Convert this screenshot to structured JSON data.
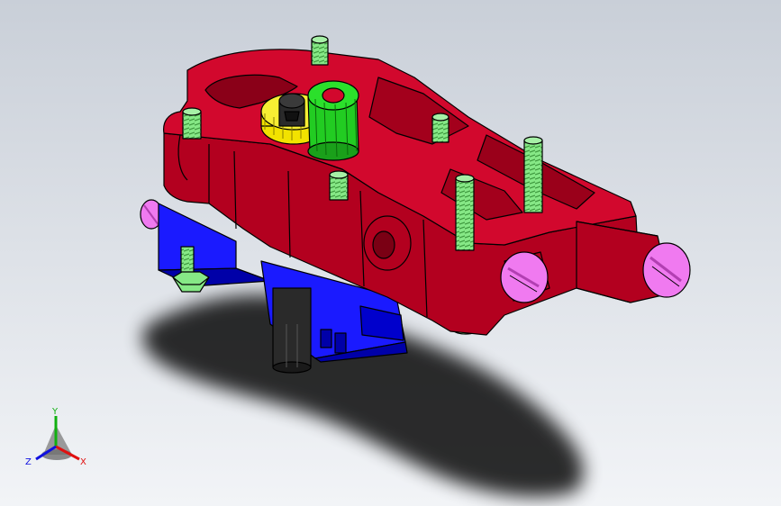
{
  "viewport": {
    "background_top": "#c9cfd8",
    "background_bottom": "#f2f4f7",
    "shadow_color": "#000000"
  },
  "model": {
    "colors": {
      "housing": "#b3001f",
      "housing_dark": "#7a0014",
      "housing_light": "#d2082d",
      "base_block": "#1a1aff",
      "base_block_dark": "#0000a8",
      "studs": "#86e886",
      "studs_dark": "#3f9a3f",
      "gear_green": "#22cc22",
      "gear_yellow": "#f2e200",
      "caps": "#f07af0",
      "caps_dark": "#b23fb2",
      "shaft": "#2a2a2a",
      "edge": "#000000"
    }
  },
  "triad": {
    "x_label": "X",
    "y_label": "Y",
    "z_label": "Z",
    "x_color": "#e01010",
    "y_color": "#10b010",
    "z_color": "#1010e0"
  }
}
